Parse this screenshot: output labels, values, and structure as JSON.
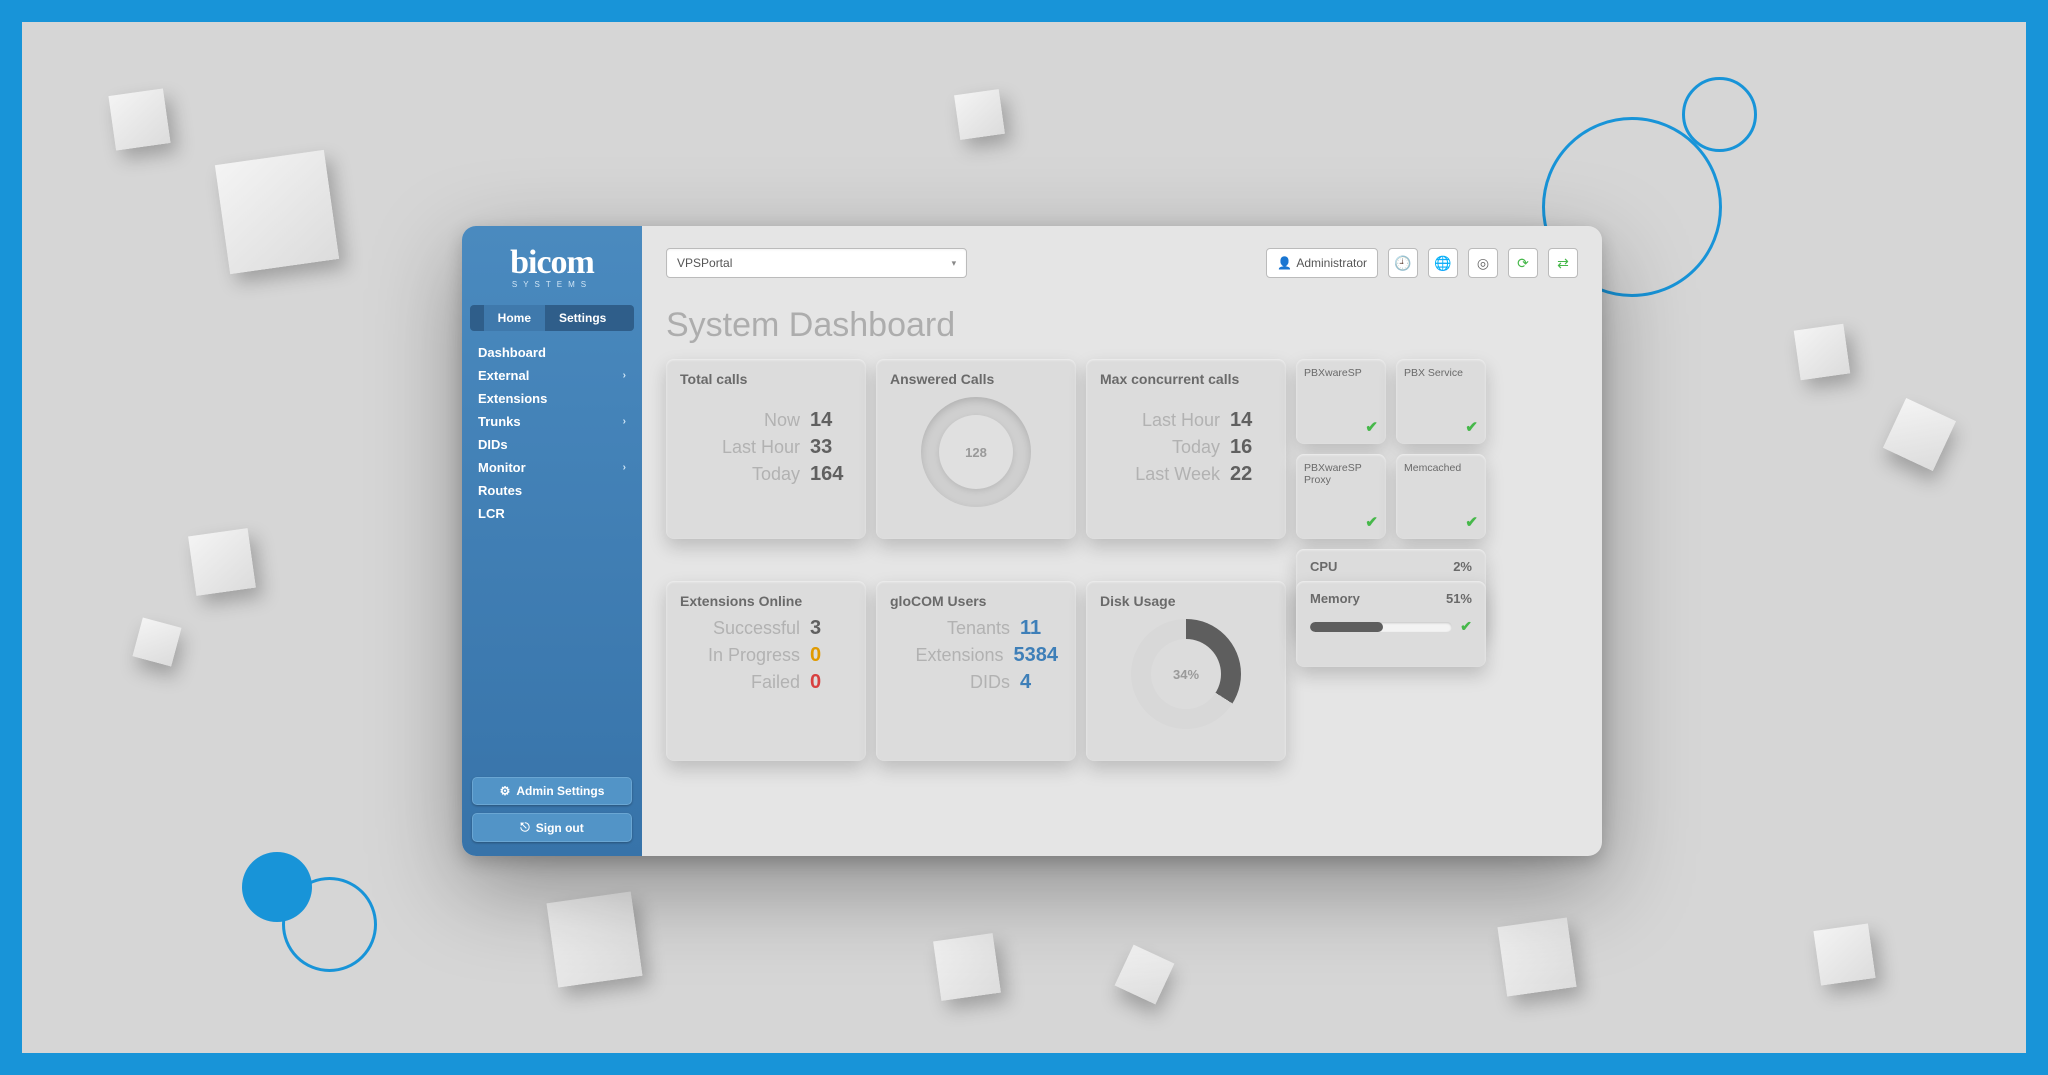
{
  "brand": {
    "name": "bicom",
    "sub": "SYSTEMS"
  },
  "tabs": {
    "home": "Home",
    "settings": "Settings"
  },
  "nav": {
    "dashboard": "Dashboard",
    "external": "External",
    "extensions": "Extensions",
    "trunks": "Trunks",
    "dids": "DIDs",
    "monitor": "Monitor",
    "routes": "Routes",
    "lcr": "LCR"
  },
  "sidebar_buttons": {
    "admin": "Admin Settings",
    "signout": "Sign out"
  },
  "topbar": {
    "select": "VPSPortal",
    "admin": "Administrator"
  },
  "page_title": "System Dashboard",
  "cards": {
    "total_calls": {
      "title": "Total calls",
      "rows": {
        "now": {
          "label": "Now",
          "val": "14"
        },
        "last_hour": {
          "label": "Last Hour",
          "val": "33"
        },
        "today": {
          "label": "Today",
          "val": "164"
        }
      }
    },
    "answered": {
      "title": "Answered Calls",
      "center": "128"
    },
    "max_concurrent": {
      "title": "Max concurrent calls",
      "rows": {
        "last_hour": {
          "label": "Last Hour",
          "val": "14"
        },
        "today": {
          "label": "Today",
          "val": "16"
        },
        "last_week": {
          "label": "Last Week",
          "val": "22"
        }
      }
    },
    "ext_online": {
      "title": "Extensions Online",
      "rows": {
        "successful": {
          "label": "Successful",
          "val": "3"
        },
        "in_progress": {
          "label": "In Progress",
          "val": "0"
        },
        "failed": {
          "label": "Failed",
          "val": "0"
        }
      }
    },
    "glocom": {
      "title": "gloCOM Users",
      "rows": {
        "tenants": {
          "label": "Tenants",
          "val": "11"
        },
        "extensions": {
          "label": "Extensions",
          "val": "5384"
        },
        "dids": {
          "label": "DIDs",
          "val": "4"
        }
      }
    },
    "disk": {
      "title": "Disk Usage",
      "pct": "34%"
    },
    "status": {
      "s1": "PBXwareSP",
      "s2": "PBX Service",
      "s3": "PBXwareSP Proxy",
      "s4": "Memcached"
    },
    "cpu": {
      "title": "CPU",
      "pct": "2%"
    },
    "memory": {
      "title": "Memory",
      "pct": "51%"
    }
  }
}
